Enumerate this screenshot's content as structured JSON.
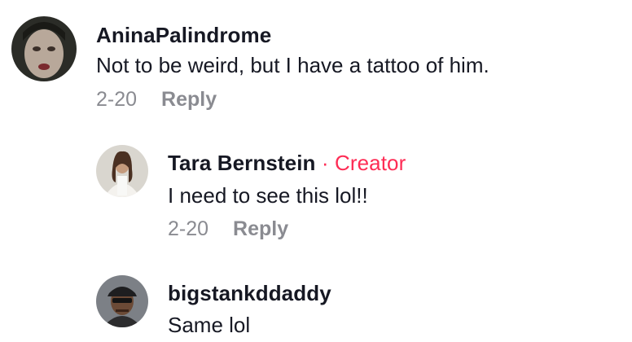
{
  "comments": [
    {
      "username": "AninaPalindrome",
      "text": "Not to be weird, but I have a tattoo of him.",
      "date": "2-20",
      "reply_label": "Reply"
    },
    {
      "username": "Tara Bernstein",
      "separator": "·",
      "badge": "Creator",
      "text": "I need to see this lol!!",
      "date": "2-20",
      "reply_label": "Reply"
    },
    {
      "username": "bigstankddaddy",
      "text": "Same lol"
    }
  ],
  "colors": {
    "creator_badge": "#fe2c55",
    "meta_text": "#8a8b91",
    "primary_text": "#161823"
  }
}
